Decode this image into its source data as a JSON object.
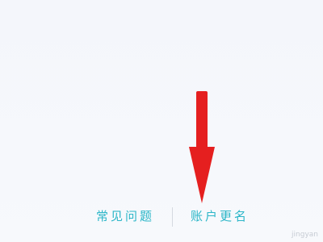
{
  "footer": {
    "links": [
      {
        "label": "常见问题"
      },
      {
        "label": "账户更名"
      }
    ]
  },
  "annotation": {
    "arrow_color": "#e51f1f",
    "arrow_direction": "down"
  },
  "watermark": "jingyan",
  "colors": {
    "background": "#f6f8fb",
    "link": "#2cb6c8",
    "divider": "#d5d9e0"
  }
}
